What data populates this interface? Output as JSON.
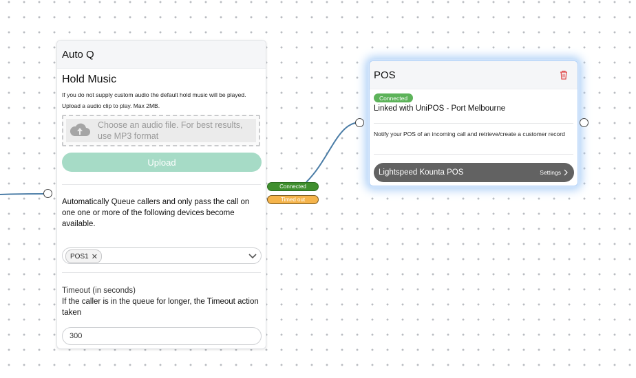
{
  "auto_q": {
    "title": "Auto Q",
    "hold_music": {
      "heading": "Hold Music",
      "description": "If you do not supply custom audio the default hold music will be played.",
      "upload_hint": "Upload a audio clip to play. Max 2MB.",
      "dropzone_text": "Choose an audio file. For best results, use MP3 format",
      "upload_label": "Upload"
    },
    "queue_description": "Automatically Queue callers and only pass the call on one one or more of the following devices become available.",
    "devices_selected": [
      "POS1"
    ],
    "timeout_label": "Timeout (in seconds)",
    "timeout_description": "If the caller is in the queue for longer, the Timeout action taken",
    "timeout_value": "300"
  },
  "outputs": {
    "connected_label": "Connected",
    "timed_out_label": "Timed out"
  },
  "pos": {
    "title": "POS",
    "status": "Connected",
    "linked_text": "Linked with UniPOS - Port Melbourne",
    "description": "Notify your POS of an incoming call and retrieve/create a customer record",
    "integration_name": "Lightspeed Kounta POS",
    "settings_label": "Settings"
  },
  "colors": {
    "connected": "#3f8f2e",
    "timed_out": "#f5b44b",
    "upload_button": "#a6dbc6",
    "wire": "#4a7ca6",
    "delete": "#e04b4b"
  }
}
